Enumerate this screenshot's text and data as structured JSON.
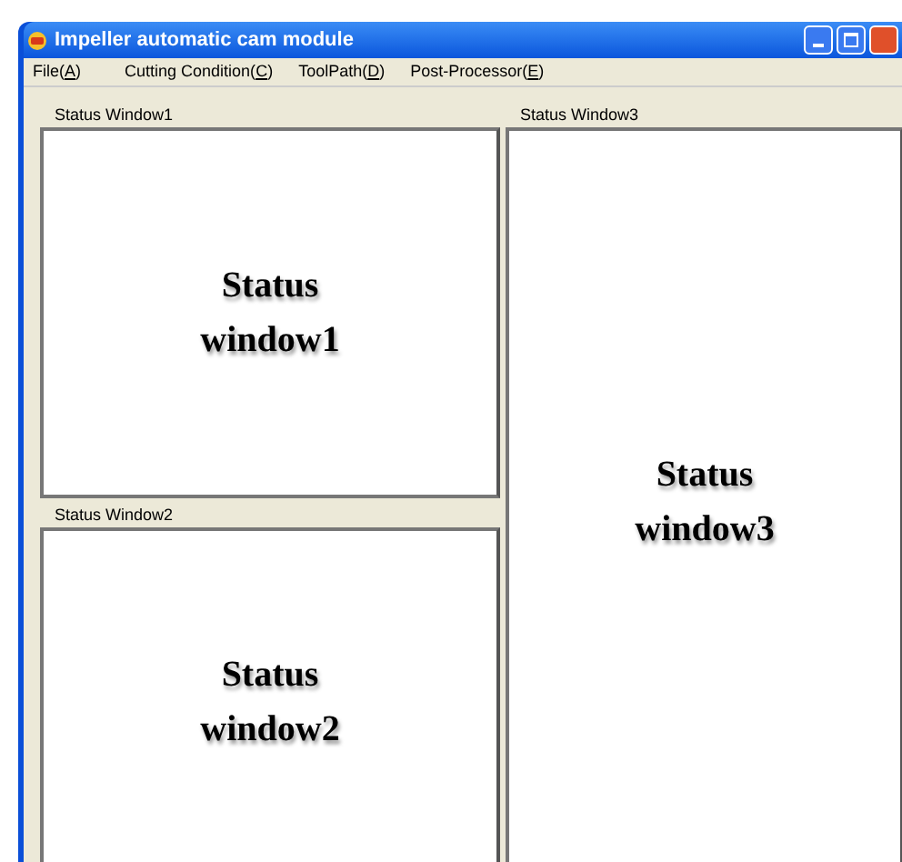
{
  "window": {
    "title": "Impeller automatic cam module"
  },
  "menu": [
    {
      "before": "File(",
      "access_key": "A",
      "after": ")"
    },
    {
      "before": "Cutting Condition(",
      "access_key": "C",
      "after": ")"
    },
    {
      "before": "ToolPath(",
      "access_key": "D",
      "after": ")"
    },
    {
      "before": "Post-Processor(",
      "access_key": "E",
      "after": ")"
    }
  ],
  "panels": [
    {
      "label": "Status Window1",
      "content_line_1": "Status",
      "content_line_2": "window1"
    },
    {
      "label": "Status Window2",
      "content_line_1": "Status",
      "content_line_2": "window2"
    },
    {
      "label": "Status Window3",
      "content_line_1": "Status",
      "content_line_2": "window3"
    }
  ]
}
